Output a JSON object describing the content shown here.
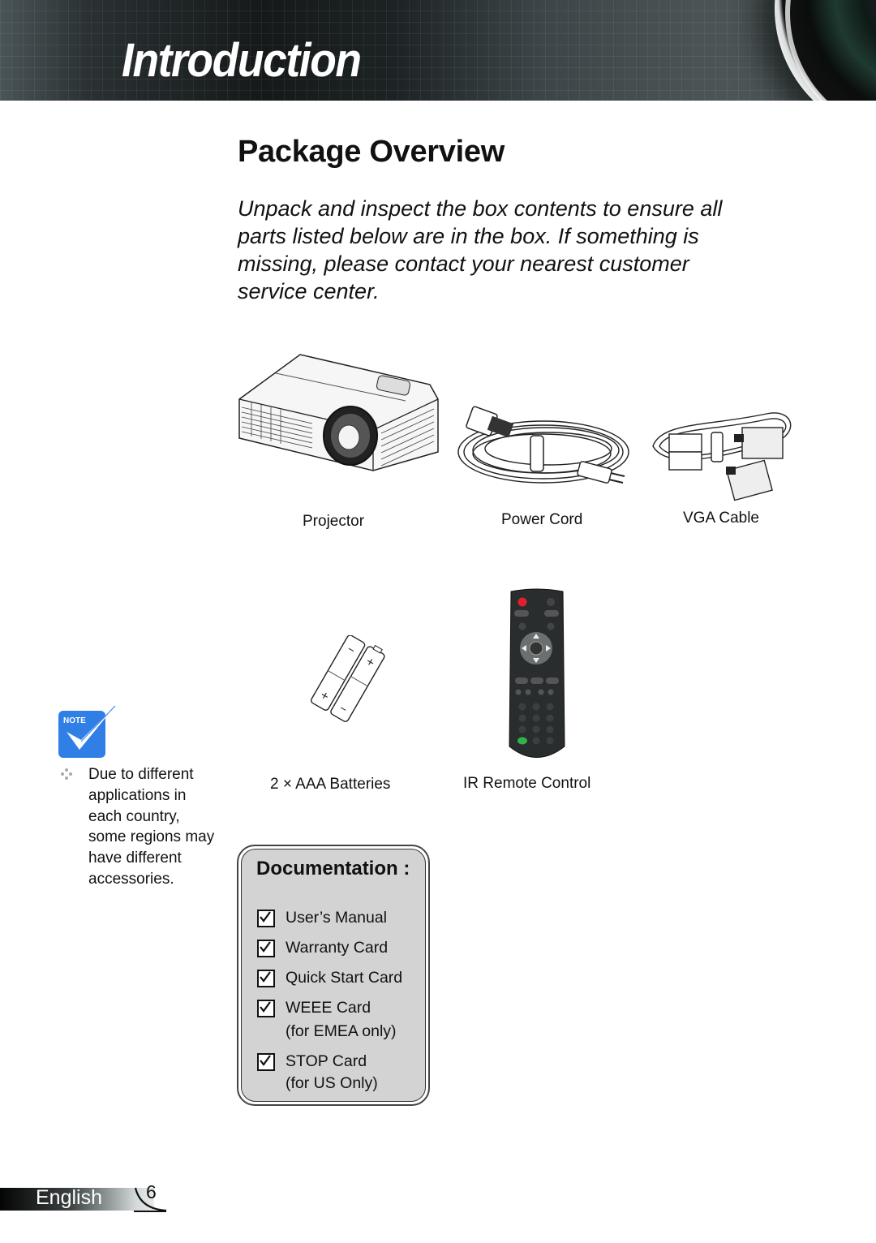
{
  "header": {
    "section_title": "Introduction"
  },
  "page": {
    "title": "Package Overview",
    "intro": "Unpack and inspect the box contents to ensure all parts listed below are in the box. If something is missing, please contact your nearest customer service center."
  },
  "items": [
    {
      "id": "projector",
      "label": "Projector",
      "icon": "projector-image"
    },
    {
      "id": "power-cord",
      "label": "Power Cord",
      "icon": "power-cord-image"
    },
    {
      "id": "vga-cable",
      "label": "VGA Cable",
      "icon": "vga-cable-image"
    },
    {
      "id": "batteries",
      "label": "2 × AAA Batteries",
      "icon": "batteries-image"
    },
    {
      "id": "remote",
      "label": "IR Remote Control",
      "icon": "remote-control-image"
    }
  ],
  "note": {
    "badge": "Note",
    "text": "Due to different applications in each country, some regions may have different accessories."
  },
  "documentation": {
    "title": "Documentation :",
    "items": [
      {
        "label": "User’s Manual",
        "sub": "",
        "checked": true
      },
      {
        "label": "Warranty Card",
        "sub": "",
        "checked": true
      },
      {
        "label": "Quick Start Card",
        "sub": "",
        "checked": true
      },
      {
        "label": "WEEE Card",
        "sub": "(for EMEA only)",
        "checked": true
      },
      {
        "label": "STOP Card",
        "sub": "(for US Only)",
        "checked": true
      }
    ]
  },
  "footer": {
    "language": "English",
    "page_number": "6"
  },
  "colors": {
    "note_blue": "#2f7fe6",
    "doc_box_fill": "#d3d3d3",
    "remote_power_red": "#e0202e",
    "remote_green": "#33b24a"
  }
}
